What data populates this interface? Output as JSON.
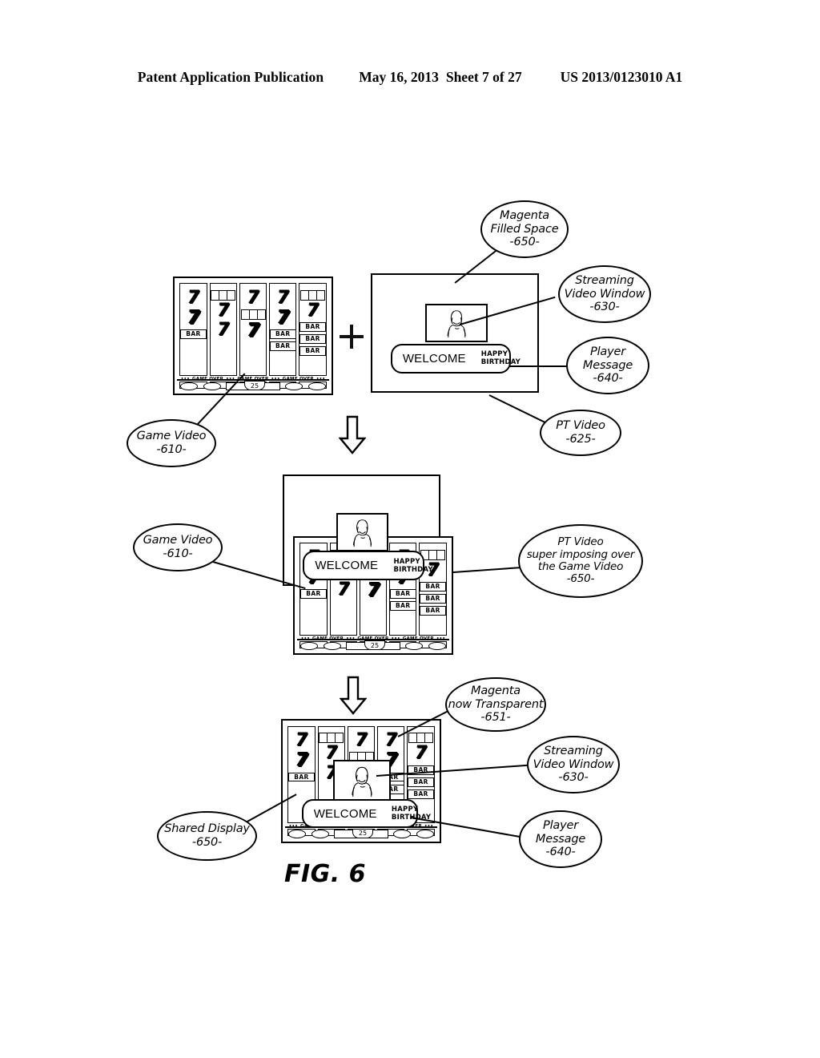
{
  "header": {
    "title": "Patent Application Publication",
    "date": "May 16, 2013",
    "sheet": "Sheet 7 of 27",
    "number": "US 2013/0123010 A1"
  },
  "figure": {
    "label": "FIG. 6",
    "operator_plus": "+",
    "arrow_down_1": "arrow-down",
    "arrow_down_2": "arrow-down"
  },
  "callouts": {
    "magenta_filled_space": [
      "Magenta",
      "Filled Space",
      "-650-"
    ],
    "streaming_video_window_top": [
      "Streaming",
      "Video Window",
      "-630-"
    ],
    "player_message_top": [
      "Player",
      "Message",
      "-640-"
    ],
    "game_video_top": [
      "Game Video",
      "-610-"
    ],
    "pt_video": [
      "PT Video",
      "-625-"
    ],
    "game_video_mid": [
      "Game Video",
      "-610-"
    ],
    "pt_super": [
      "PT Video",
      "super imposing over",
      "the Game Video",
      "-650-"
    ],
    "magenta_transparent": [
      "Magenta",
      "now Transparent",
      "-651-"
    ],
    "streaming_video_window_bottom": [
      "Streaming",
      "Video Window",
      "-630-"
    ],
    "player_message_bottom": [
      "Player",
      "Message",
      "-640-"
    ],
    "shared_display": [
      "Shared Display",
      "-650-"
    ]
  },
  "slot_machine": {
    "credit_value": "25",
    "game_over_label": "GAME OVER",
    "dots_label": "•••",
    "bar_label": "BAR",
    "seven_label": "7",
    "reels": [
      {
        "symbols": [
          {
            "type": "seven"
          },
          {
            "type": "seven-bold"
          },
          {
            "type": "bar"
          }
        ]
      },
      {
        "symbols": [
          {
            "type": "tripbox"
          },
          {
            "type": "seven"
          },
          {
            "type": "seven"
          }
        ]
      },
      {
        "symbols": [
          {
            "type": "seven"
          },
          {
            "type": "tripbox"
          },
          {
            "type": "seven-bold"
          }
        ]
      },
      {
        "symbols": [
          {
            "type": "seven"
          },
          {
            "type": "seven-bold"
          },
          {
            "type": "bar"
          },
          {
            "type": "bar"
          }
        ]
      },
      {
        "symbols": [
          {
            "type": "tripbox"
          },
          {
            "type": "seven"
          },
          {
            "type": "bar"
          },
          {
            "type": "bar"
          },
          {
            "type": "bar"
          }
        ]
      }
    ]
  },
  "player_message": {
    "welcome": "WELCOME",
    "greeting": "HAPPY BIRTHDAY"
  },
  "colors": {
    "line": "#000000",
    "background": "#ffffff"
  }
}
